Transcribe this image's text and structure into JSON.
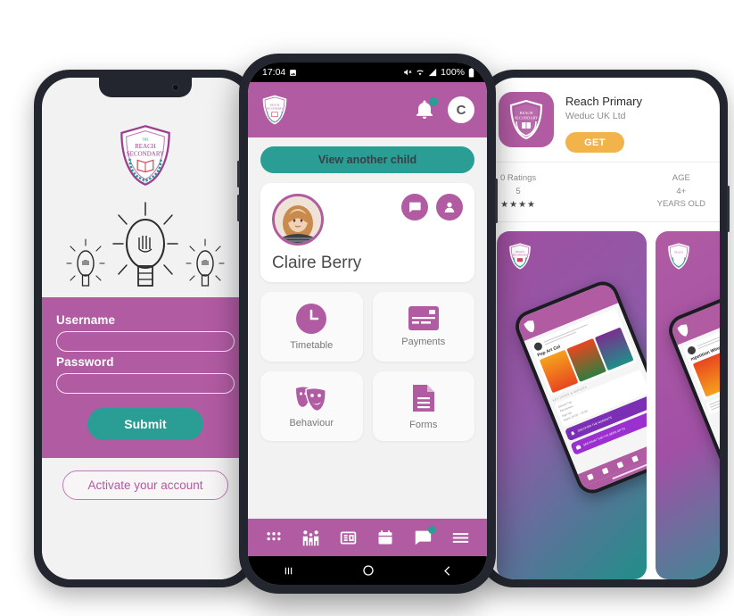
{
  "scene": {
    "title": "Weduc school app phone mockups",
    "brand_purple": "#b15ba3",
    "brand_teal": "#2a9d94",
    "accent_orange": "#f2b34a"
  },
  "left_phone": {
    "name": "login-screen",
    "logo": {
      "icon": "school-shield-icon",
      "line1": "REACH",
      "line2": "SECONDARY"
    },
    "illustration": "lightbulb-icon",
    "form": {
      "username_label": "Username",
      "username_value": "",
      "username_placeholder": "",
      "password_label": "Password",
      "password_value": "",
      "password_placeholder": "",
      "submit_label": "Submit"
    },
    "activate_label": "Activate your account"
  },
  "center_phone": {
    "name": "parent-dashboard",
    "status_bar": {
      "time": "17:04",
      "screenshot_icon": "image-icon",
      "mute_icon": "mute-icon",
      "wifi_icon": "wifi-icon",
      "signal_icon": "signal-icon",
      "battery_text": "100%",
      "battery_icon": "battery-icon"
    },
    "header": {
      "logo_icon": "school-shield-icon",
      "bell_icon": "bell-icon",
      "bell_badge": "",
      "avatar_initial": "C"
    },
    "view_another_child_label": "View another child",
    "child": {
      "name": "Claire Berry",
      "avatar_icon": "student-avatar",
      "message_icon": "chat-bubble-icon",
      "profile_icon": "person-icon"
    },
    "tiles": [
      {
        "label": "Timetable",
        "icon": "clock-icon"
      },
      {
        "label": "Payments",
        "icon": "credit-card-icon"
      },
      {
        "label": "Behaviour",
        "icon": "theatre-masks-icon"
      },
      {
        "label": "Forms",
        "icon": "document-icon"
      }
    ],
    "bottom_nav": [
      {
        "icon": "apps-grid-icon",
        "badge": false
      },
      {
        "icon": "family-icon",
        "badge": false
      },
      {
        "icon": "newspaper-icon",
        "badge": false
      },
      {
        "icon": "calendar-icon",
        "badge": false
      },
      {
        "icon": "chat-bubble-icon",
        "badge": true
      },
      {
        "icon": "hamburger-menu-icon",
        "badge": false
      }
    ],
    "android_nav": {
      "recents_icon": "recents-icon",
      "home_icon": "home-icon",
      "back_icon": "back-icon"
    }
  },
  "right_phone": {
    "name": "app-store-listing",
    "app_icon": "school-shield-app-icon",
    "app_title": "Reach Primary",
    "developer": "Weduc UK Ltd",
    "get_label": "GET",
    "stats": [
      {
        "line1": "0 Ratings",
        "line2": "5",
        "line3": "★★★★"
      },
      {
        "line1": "AGE",
        "line2": "4+",
        "line3": "YEARS OLD"
      }
    ],
    "screenshots": [
      {
        "logo_icon": "school-shield-icon",
        "post_title": "Pop Art Col",
        "section_label": "KEY DATES & NOTICES",
        "info_line1": "School Trip",
        "info_line2": "Permission",
        "info_line3": "Sign Up",
        "info_line4": "Starts 14:00 – 15:00",
        "banner1": "DISCOVER THE MOMENTS",
        "banner2": "SEE WHAT THEY'VE BEEN UP TO",
        "banner_close": "×"
      },
      {
        "logo_icon": "school-shield-icon",
        "post_title": "mpetition Winn",
        "section_label": ""
      }
    ]
  }
}
